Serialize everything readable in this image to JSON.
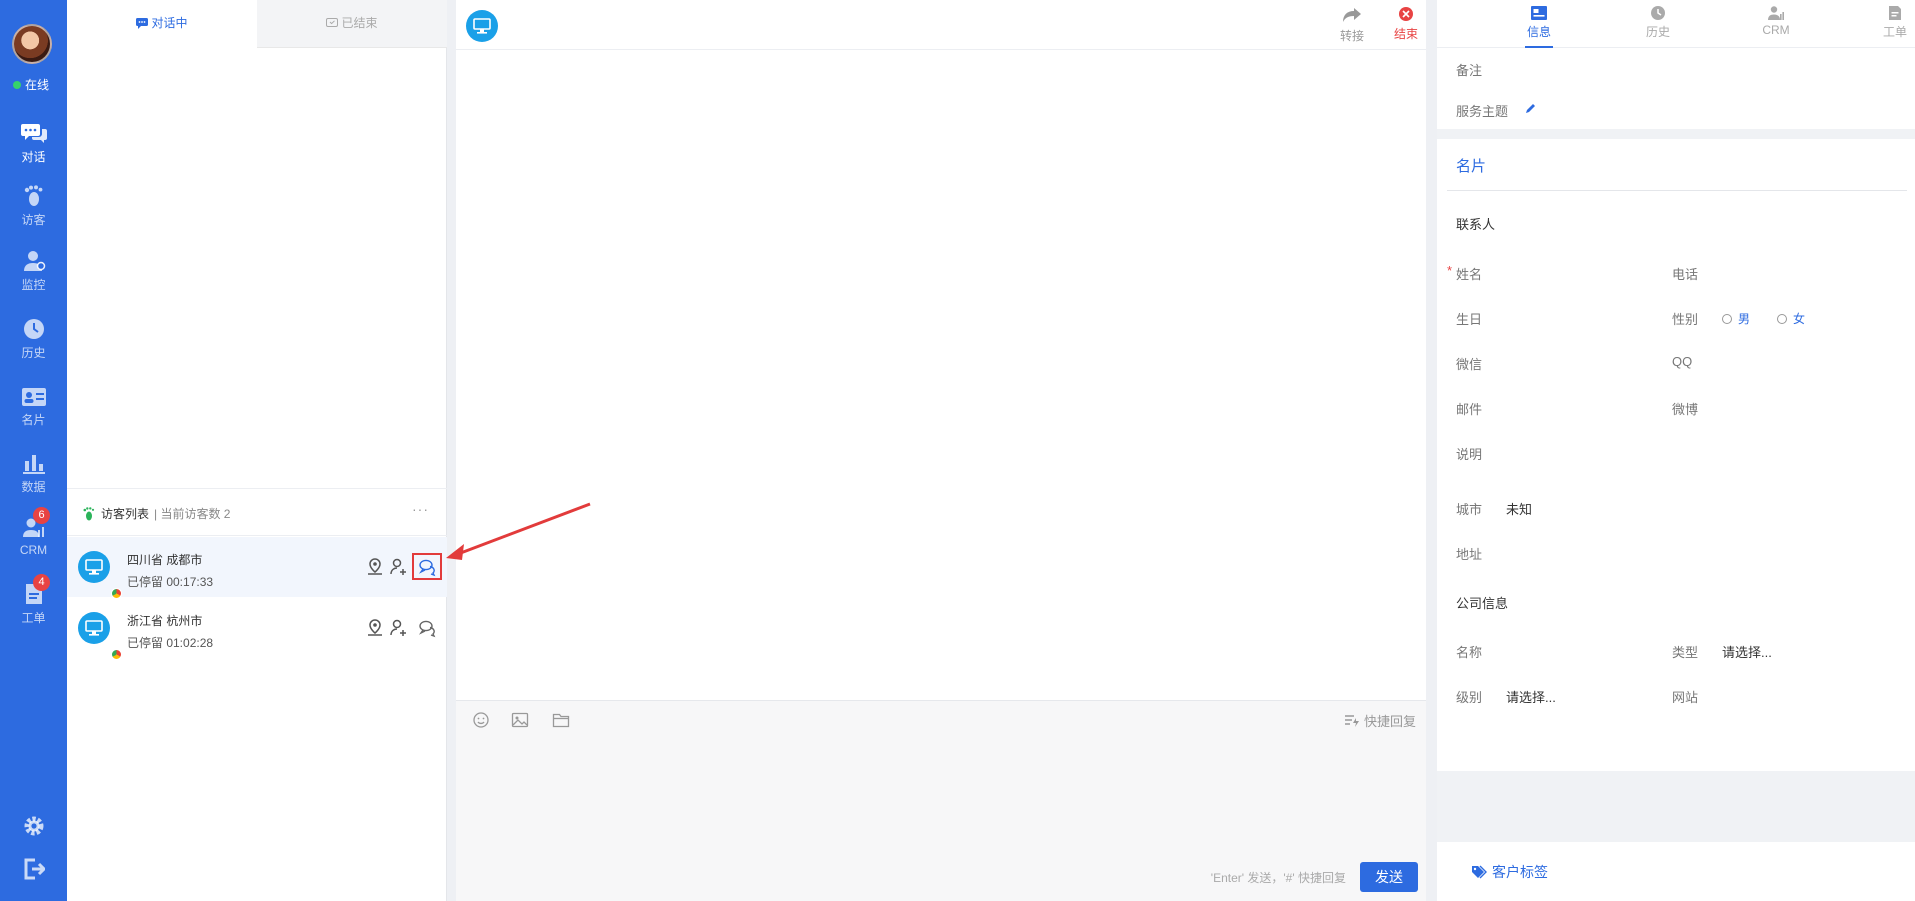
{
  "nav": {
    "status": "在线",
    "items": [
      {
        "label": "对话",
        "icon": "chat-icon"
      },
      {
        "label": "访客",
        "icon": "footprint-icon"
      },
      {
        "label": "监控",
        "icon": "monitor-user-icon"
      },
      {
        "label": "历史",
        "icon": "clock-icon"
      },
      {
        "label": "名片",
        "icon": "card-icon"
      },
      {
        "label": "数据",
        "icon": "bar-chart-icon"
      },
      {
        "label": "CRM",
        "icon": "crm-icon",
        "badge": "6"
      },
      {
        "label": "工单",
        "icon": "ticket-icon",
        "badge": "4"
      }
    ]
  },
  "convo_tabs": {
    "active": "对话中",
    "ended": "已结束"
  },
  "visitor_list": {
    "title": "访客列表",
    "count_text": "| 当前访客数 2",
    "more": "···",
    "rows": [
      {
        "location": "四川省 成都市",
        "stay": "已停留 00:17:33"
      },
      {
        "location": "浙江省 杭州市",
        "stay": "已停留 01:02:28"
      }
    ]
  },
  "chat": {
    "transfer": "转接",
    "end": "结束",
    "quick_reply": "快捷回复",
    "hint": "'Enter' 发送，'#' 快捷回复",
    "send": "发送"
  },
  "info": {
    "tabs": [
      "信息",
      "历史",
      "CRM",
      "工单"
    ],
    "remark": "备注",
    "topic": "服务主题",
    "card_title": "名片",
    "contact_section": "联系人",
    "fields": {
      "name": "姓名",
      "phone": "电话",
      "birthday": "生日",
      "gender": "性别",
      "male": "男",
      "female": "女",
      "wechat": "微信",
      "qq": "QQ",
      "email": "邮件",
      "weibo": "微博",
      "desc": "说明",
      "city": "城市",
      "city_value": "未知",
      "address": "地址"
    },
    "company_section": "公司信息",
    "company": {
      "name": "名称",
      "type": "类型",
      "type_value": "请选择...",
      "level": "级别",
      "level_value": "请选择...",
      "website": "网站"
    },
    "customer_tag": "客户标签"
  },
  "colors": {
    "primary": "#2d6be0",
    "badge": "#e84343",
    "online": "#36d36b",
    "annotation": "#e23b3b"
  }
}
